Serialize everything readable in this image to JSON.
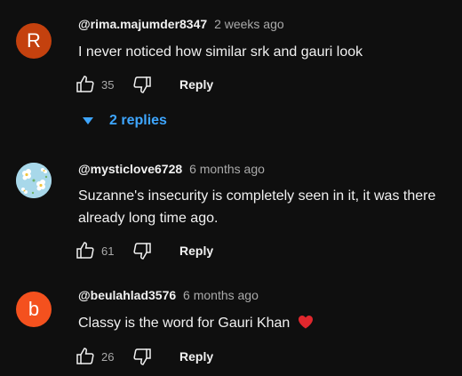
{
  "colors": {
    "background": "#0f0f0f",
    "link": "#3ea6ff",
    "avatar_r": "#c4410e",
    "avatar_b": "#f4511e",
    "heart": "#e0272d"
  },
  "comments": [
    {
      "author": "@rima.majumder8347",
      "time": "2 weeks ago",
      "avatar_letter": "R",
      "text": "I never noticed how similar srk and gauri look",
      "likes": "35",
      "reply_label": "Reply",
      "replies_label": "2 replies"
    },
    {
      "author": "@mysticlove6728",
      "time": "6 months ago",
      "avatar_letter": "",
      "text": "Suzanne's insecurity is completely seen in it, it  was there already long time ago.",
      "likes": "61",
      "reply_label": "Reply"
    },
    {
      "author": "@beulahlad3576",
      "time": "6 months ago",
      "avatar_letter": "b",
      "text": "Classy is the word for Gauri Khan",
      "emoji": "heart-emoji",
      "likes": "26",
      "reply_label": "Reply"
    }
  ]
}
